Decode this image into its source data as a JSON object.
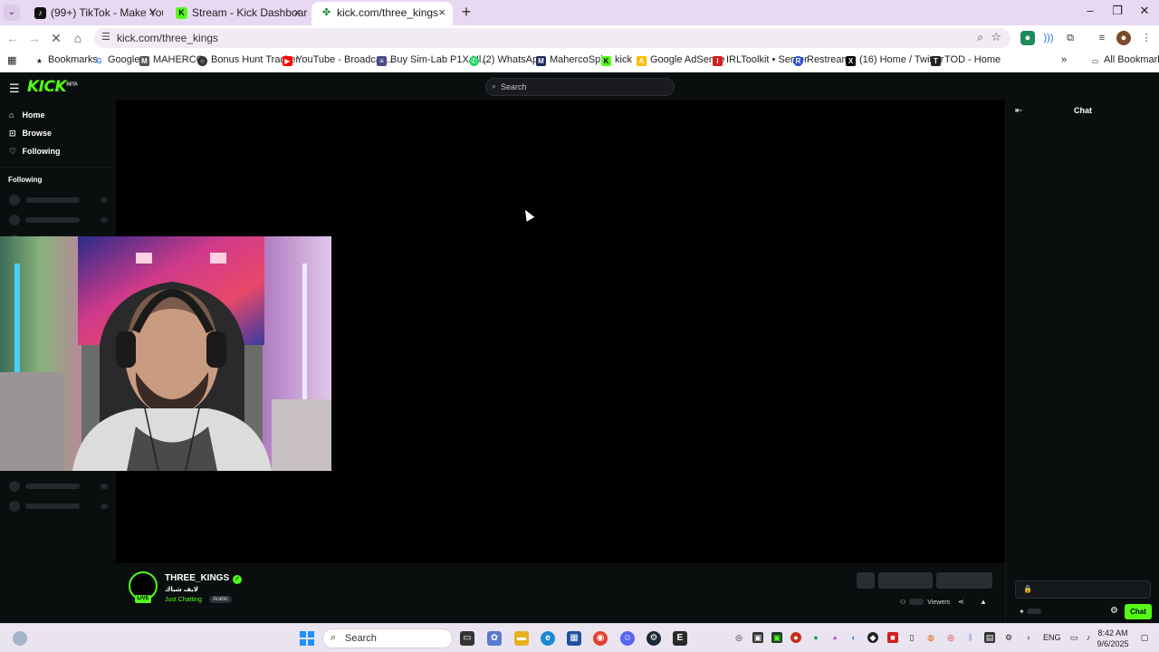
{
  "browser": {
    "tabs": [
      {
        "title": "(99+) TikTok - Make Your Day",
        "favicon": "tiktok-icon",
        "active": false
      },
      {
        "title": "Stream - Kick Dashboard",
        "favicon": "kick-icon",
        "active": false
      },
      {
        "title": "kick.com/three_kings",
        "favicon": "kick-loading-icon",
        "active": true
      }
    ],
    "url": "kick.com/three_kings",
    "bookmarks": [
      "Bookmarks",
      "Google",
      "MAHERCO",
      "Bonus Hunt Tracker",
      "YouTube - Broadcas...",
      "Buy Sim-Lab P1X Ul...",
      "(2) WhatsApp",
      "MahercoSpin",
      "kick",
      "Google AdSense",
      "IRLToolkit • Server",
      "Restream",
      "(16) Home / Twitter",
      "TOD - Home"
    ],
    "all_bookmarks": "All Bookmarks"
  },
  "kick": {
    "logo": "KICK",
    "logo_badge": "BETA",
    "search_placeholder": "Search",
    "nav": [
      {
        "label": "Home",
        "icon": "home-icon"
      },
      {
        "label": "Browse",
        "icon": "browse-icon"
      },
      {
        "label": "Following",
        "icon": "heart-icon"
      }
    ],
    "following_heading": "Following",
    "chat": {
      "title": "Chat",
      "send_label": "Chat"
    },
    "stream": {
      "channel": "THREE_KINGS",
      "title": "لايف شباك",
      "category": "Just Chatting",
      "tag": "Arabic",
      "live_label": "LIVE",
      "viewers_label": "Viewers"
    }
  },
  "taskbar": {
    "search_label": "Search",
    "language": "ENG",
    "time": "8:42 AM",
    "date": "9/6/2025"
  },
  "colors": {
    "kick_green": "#53fc18",
    "page_bg": "#0b0e0f"
  }
}
